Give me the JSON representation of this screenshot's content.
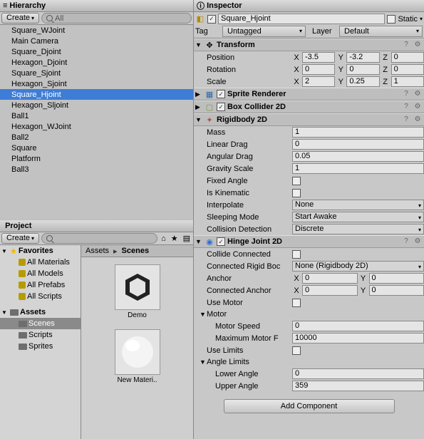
{
  "hierarchy": {
    "title": "Hierarchy",
    "create_label": "Create",
    "search_placeholder": "All",
    "items": [
      "Square_WJoint",
      "Main Camera",
      "Square_Djoint",
      "Hexagon_Djoint",
      "Square_Sjoint",
      "Hexagon_Sjoint",
      "Square_Hjoint",
      "Hexagon_Sljoint",
      "Ball1",
      "Hexagon_WJoint",
      "Ball2",
      "Square",
      "Platform",
      "Ball3"
    ],
    "selected_index": 6
  },
  "project": {
    "title": "Project",
    "create_label": "Create",
    "favorites_label": "Favorites",
    "favorites": [
      "All Materials",
      "All Models",
      "All Prefabs",
      "All Scripts"
    ],
    "assets_label": "Assets",
    "asset_folders": [
      "Scenes",
      "Scripts",
      "Sprites"
    ],
    "selected_folder": "Scenes",
    "breadcrumb": [
      "Assets",
      "Scenes"
    ],
    "thumbs": [
      {
        "name": "Demo",
        "kind": "unity"
      },
      {
        "name": "New Materi..",
        "kind": "sphere"
      }
    ]
  },
  "inspector": {
    "title": "Inspector",
    "object_name": "Square_Hjoint",
    "enabled": true,
    "static_label": "Static",
    "tag_label": "Tag",
    "tag_value": "Untagged",
    "layer_label": "Layer",
    "layer_value": "Default",
    "transform": {
      "title": "Transform",
      "position": {
        "label": "Position",
        "x": "-3.5",
        "y": "-3.2",
        "z": "0"
      },
      "rotation": {
        "label": "Rotation",
        "x": "0",
        "y": "0",
        "z": "0"
      },
      "scale": {
        "label": "Scale",
        "x": "2",
        "y": "0.25",
        "z": "1"
      }
    },
    "sprite_renderer": {
      "title": "Sprite Renderer",
      "enabled": true
    },
    "box_collider": {
      "title": "Box Collider 2D",
      "enabled": true
    },
    "rigidbody": {
      "title": "Rigidbody 2D",
      "mass": {
        "label": "Mass",
        "value": "1"
      },
      "linear_drag": {
        "label": "Linear Drag",
        "value": "0"
      },
      "angular_drag": {
        "label": "Angular Drag",
        "value": "0.05"
      },
      "gravity_scale": {
        "label": "Gravity Scale",
        "value": "1"
      },
      "fixed_angle": {
        "label": "Fixed Angle",
        "value": false
      },
      "is_kinematic": {
        "label": "Is Kinematic",
        "value": false
      },
      "interpolate": {
        "label": "Interpolate",
        "value": "None"
      },
      "sleeping_mode": {
        "label": "Sleeping Mode",
        "value": "Start Awake"
      },
      "collision_detection": {
        "label": "Collision Detection",
        "value": "Discrete"
      }
    },
    "hinge_joint": {
      "title": "Hinge Joint 2D",
      "enabled": true,
      "collide_connected": {
        "label": "Collide Connected",
        "value": false
      },
      "connected_body": {
        "label": "Connected Rigid Boc",
        "value": "None (Rigidbody 2D)"
      },
      "anchor": {
        "label": "Anchor",
        "x": "0",
        "y": "0"
      },
      "connected_anchor": {
        "label": "Connected Anchor",
        "x": "0",
        "y": "0"
      },
      "use_motor": {
        "label": "Use Motor",
        "value": false
      },
      "motor": {
        "label": "Motor",
        "speed": {
          "label": "Motor Speed",
          "value": "0"
        },
        "max_force": {
          "label": "Maximum Motor F",
          "value": "10000"
        }
      },
      "use_limits": {
        "label": "Use Limits",
        "value": false
      },
      "angle_limits": {
        "label": "Angle Limits",
        "lower": {
          "label": "Lower Angle",
          "value": "0"
        },
        "upper": {
          "label": "Upper Angle",
          "value": "359"
        }
      }
    },
    "add_component_label": "Add Component"
  }
}
